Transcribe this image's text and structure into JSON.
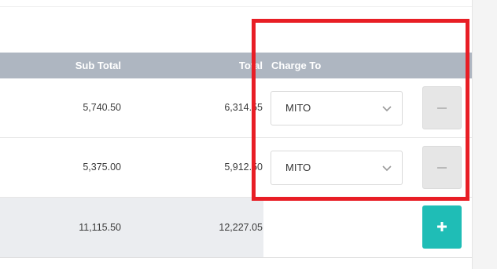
{
  "table": {
    "headers": {
      "sub_total": "Sub Total",
      "total": "Total",
      "charge_to": "Charge To"
    },
    "rows": [
      {
        "sub_total": "5,740.50",
        "total": "6,314.55",
        "charge_to": "MITO"
      },
      {
        "sub_total": "5,375.00",
        "total": "5,912.50",
        "charge_to": "MITO"
      }
    ],
    "footer": {
      "sub_total": "11,115.50",
      "total": "12,227.05"
    }
  },
  "icons": {
    "dropdown": "chevron-down-icon",
    "remove": "minus-icon",
    "add": "plus-icon"
  },
  "colors": {
    "header_bg": "#aeb6c1",
    "add_button": "#1fbdb6",
    "highlight": "#e81e25"
  }
}
